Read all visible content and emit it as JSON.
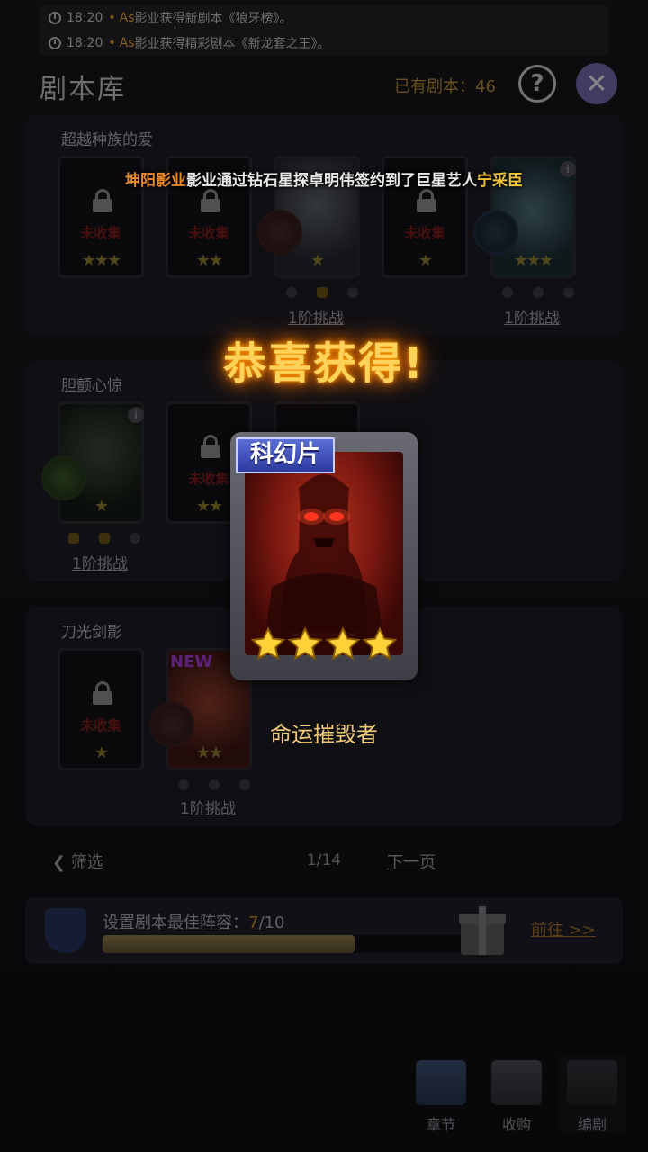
{
  "news": [
    {
      "time": "18:20",
      "user": "As",
      "text": "影业获得新剧本《狼牙榜》。"
    },
    {
      "time": "18:20",
      "user": "As",
      "text": "影业获得精彩剧本《新龙套之王》。"
    }
  ],
  "header": {
    "title": "剧本库",
    "owned_label": "已有剧本：46",
    "help_label": "?",
    "close_label": "✕"
  },
  "groups": [
    {
      "title": "超越种族的爱",
      "challenge_a": "1阶挑战",
      "challenge_b": "1阶挑战"
    },
    {
      "title": "胆颤心惊",
      "challenge_a": "1阶挑战"
    },
    {
      "title": "刀光剑影",
      "challenge_a": "1阶挑战",
      "new_tag": "NEW"
    }
  ],
  "card_status": {
    "uncollected": "未收集"
  },
  "pagination": {
    "filter_label": "筛选",
    "page": "1/14",
    "next_label": "下一页"
  },
  "lineup": {
    "label": "设置剧本最佳阵容：",
    "current": "7",
    "total": "/10",
    "progress": 0.7,
    "goto_label": "前往 >>"
  },
  "bottom_nav": [
    {
      "label": "章节",
      "icon": "books-icon"
    },
    {
      "label": "收购",
      "icon": "handshake-icon"
    },
    {
      "label": "编剧",
      "icon": "writer-icon"
    }
  ],
  "signing_banner": {
    "studio": "坤阳影业",
    "text": "影业通过钻石星探卓明伟签约到了巨星艺人",
    "artist": "宁采臣"
  },
  "reward": {
    "congrats": "恭喜获得!",
    "genre": "科幻片",
    "stars": 4,
    "name": "命运摧毁者"
  },
  "colors": {
    "accent_gold": "#ffd35a",
    "card_name": "#f1c879",
    "genre_tag": "#3f52c4",
    "studio_orange": "#e88a2c"
  }
}
